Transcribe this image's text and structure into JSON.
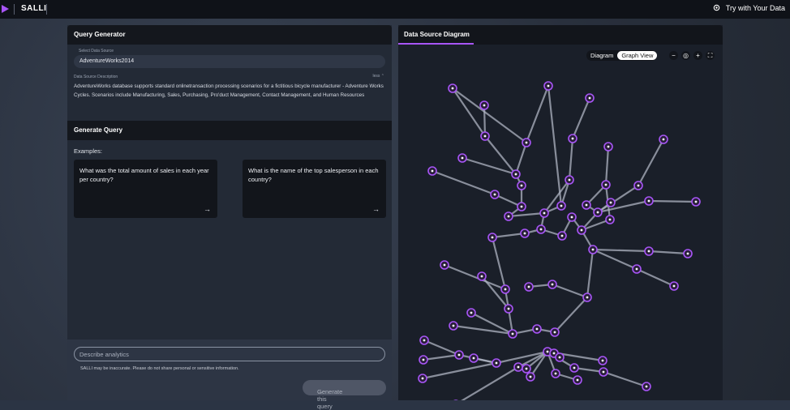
{
  "app": {
    "brand": "SALLI",
    "try_label": "Try with Your Data"
  },
  "query_generator": {
    "title": "Query Generator",
    "select_label": "Select Data Source",
    "selected_source": "AdventureWorks2014",
    "desc_label": "Data Source Description",
    "less_label": "less",
    "description": "AdventureWorks database supports standard onlinetransaction processing scenarios for a fictitious bicycle manufacturer - Adventure Works Cycles. Scenarios include Manufacturing, Sales, Purchasing, Pro'duct Management, Contact Management, and Human Resources"
  },
  "generate_query": {
    "title": "Generate Query",
    "examples_label": "Examples:",
    "examples": [
      {
        "text": "What was the total amount of sales in each year per country?"
      },
      {
        "text": "What is the name of the top salesperson in each country?"
      }
    ],
    "prompt_placeholder": "Describe analytics",
    "disclaimer": "SALLI may be inaccurate. Please do not share personal or sensitive information.",
    "generate_label": "Generate this query"
  },
  "diagram": {
    "title": "Data Source Diagram",
    "view_options": [
      "Diagram",
      "Graph View"
    ],
    "active_view": "Graph View",
    "colors": {
      "accent": "#a855f7",
      "node_fill": "#2a1f3a",
      "edge": "#aeb4c2"
    }
  }
}
